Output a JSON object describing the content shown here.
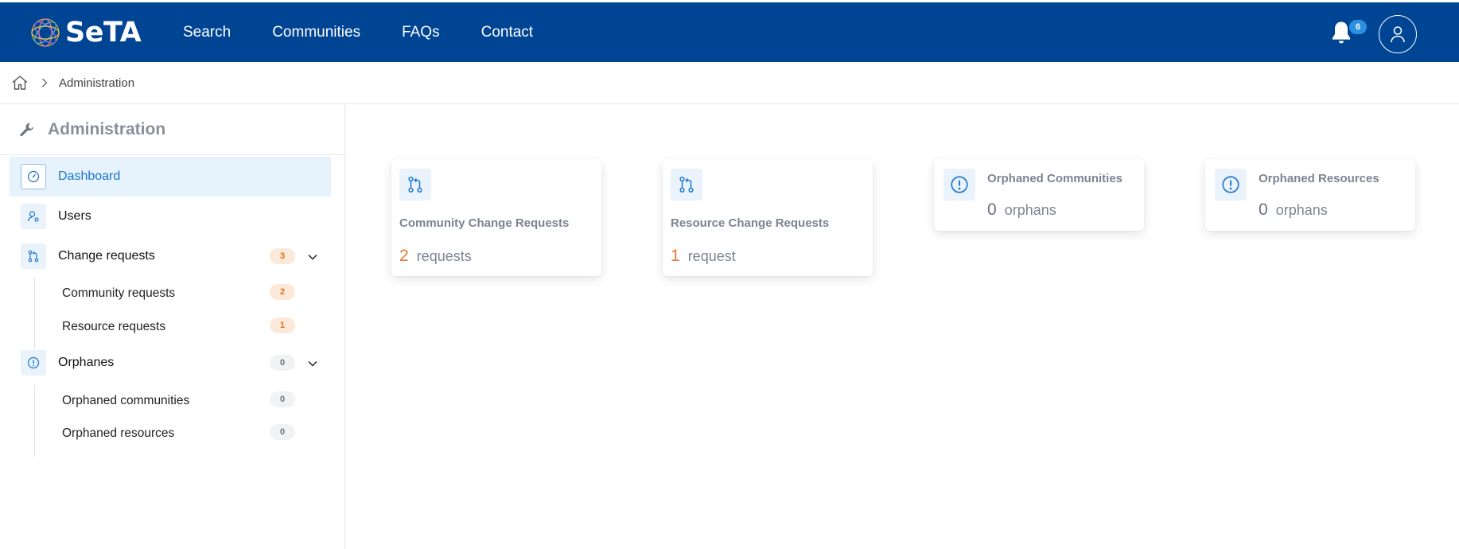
{
  "app": {
    "name": "SeTA"
  },
  "nav": {
    "items": [
      {
        "label": "Search"
      },
      {
        "label": "Communities"
      },
      {
        "label": "FAQs"
      },
      {
        "label": "Contact"
      }
    ],
    "notifications_count": "6",
    "icons": [
      "bell-icon",
      "user-icon"
    ]
  },
  "breadcrumb": {
    "items": [
      "Administration"
    ],
    "icons": [
      "home-icon",
      "chevron-right-icon"
    ]
  },
  "sidebar": {
    "title": "Administration",
    "icon": "wrench-icon",
    "items": [
      {
        "label": "Dashboard",
        "icon": "gauge-icon",
        "active": true
      },
      {
        "label": "Users",
        "icon": "user-gear-icon"
      },
      {
        "label": "Change requests",
        "icon": "pull-request-icon",
        "badge": "3",
        "children": [
          {
            "label": "Community requests",
            "badge": "2"
          },
          {
            "label": "Resource requests",
            "badge": "1"
          }
        ]
      },
      {
        "label": "Orphanes",
        "icon": "alert-circle-icon",
        "badge": "0",
        "children": [
          {
            "label": "Orphaned communities",
            "badge": "0"
          },
          {
            "label": "Orphaned resources",
            "badge": "0"
          }
        ]
      }
    ]
  },
  "cards": [
    {
      "title": "Community Change Requests",
      "value": "2",
      "unit": "requests",
      "icon": "pull-request-icon"
    },
    {
      "title": "Resource Change Requests",
      "value": "1",
      "unit": "request",
      "icon": "pull-request-icon"
    },
    {
      "title": "Orphaned Communities",
      "value": "0",
      "unit": "orphans",
      "icon": "alert-circle-icon"
    },
    {
      "title": "Orphaned Resources",
      "value": "0",
      "unit": "orphans",
      "icon": "alert-circle-icon"
    }
  ],
  "colors": {
    "header_bg": "#004494",
    "accent_blue": "#1b75d0",
    "accent_orange": "#e8772e",
    "active_bg": "#e6f2fc"
  }
}
